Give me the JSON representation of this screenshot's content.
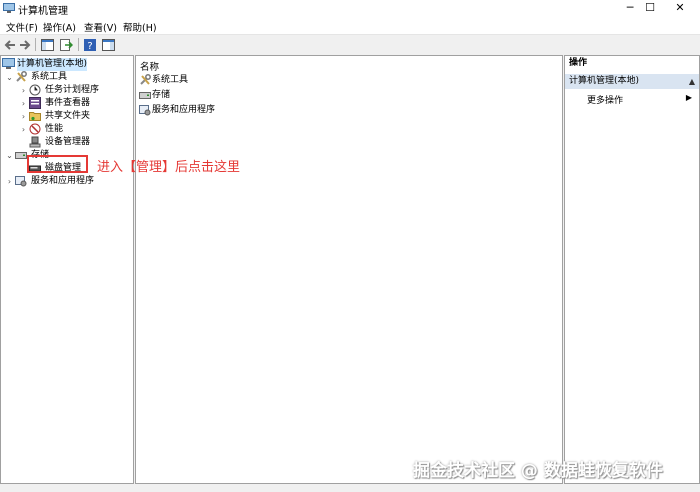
{
  "window": {
    "title": "计算机管理",
    "minimize_glyph": "─",
    "maximize_glyph": "☐",
    "close_glyph": "✕"
  },
  "menu": {
    "items": [
      "文件(F)",
      "操作(A)",
      "查看(V)",
      "帮助(H)"
    ]
  },
  "toolbar": {
    "icons": [
      "back-arrow-icon",
      "forward-arrow-icon",
      "show-console-tree-icon",
      "export-list-icon",
      "help-icon",
      "show-action-pane-icon"
    ]
  },
  "tree": {
    "root": "计算机管理(本地)",
    "system_tools": "系统工具",
    "task_scheduler": "任务计划程序",
    "event_viewer": "事件查看器",
    "shared_folders": "共享文件夹",
    "performance": "性能",
    "device_manager": "设备管理器",
    "storage": "存储",
    "disk_management": "磁盘管理",
    "services_apps": "服务和应用程序"
  },
  "list": {
    "column_header": "名称",
    "items": [
      "系统工具",
      "存储",
      "服务和应用程序"
    ]
  },
  "actions": {
    "header": "操作",
    "section": "计算机管理(本地)",
    "more": "更多操作"
  },
  "annotation": {
    "text": "进入【管理】后点击这里",
    "color": "#e53935"
  },
  "watermark": "掘金技术社区 @ 数据蛙恢复软件"
}
